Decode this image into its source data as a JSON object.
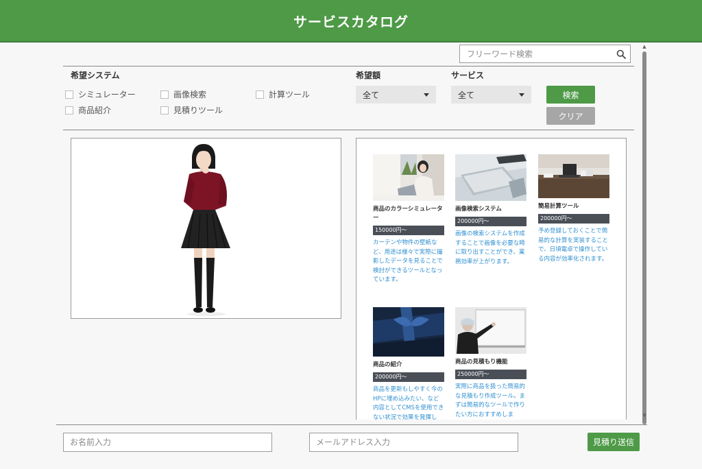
{
  "header": {
    "title": "サービスカタログ"
  },
  "search": {
    "placeholder": "フリーワード検索"
  },
  "filters": {
    "system_label": "希望システム",
    "systems": [
      "シミュレーター",
      "画像検索",
      "計算ツール",
      "商品紹介",
      "見積りツール"
    ],
    "amount_label": "希望額",
    "amount_value": "全て",
    "service_label": "サービス",
    "service_value": "全て",
    "search_button": "検索",
    "clear_button": "クリア"
  },
  "catalog": {
    "items": [
      {
        "name": "商品のカラーシミュレーター",
        "price": "150000円〜",
        "desc": "カーテンや物件の壁紙など、用途は様々で実際に撮影したデータを見ることで検討ができるツールとなっています。"
      },
      {
        "name": "画像検索システム",
        "price": "200000円〜",
        "desc": "画像の検索システムを作成することで画像を必要な時に取り出すことができ、業務効率が上がります。"
      },
      {
        "name": "簡易計算ツール",
        "price": "200000円〜",
        "desc": "予め登録しておくことで簡易的な計算を実装することで、日頃電卓で操作している内容が効率化されます。"
      },
      {
        "name": "商品の紹介",
        "price": "200000円〜",
        "desc": "商品を更新もしやすく今のHPに埋め込みたい、など内容としてCMSを使用できない状況で効果を発揮し"
      },
      {
        "name": "商品の見積もり機能",
        "price": "250000円〜",
        "desc": "実際に商品を扱った簡易的な見積もり作成ツール。まずは簡易的なツールで作りたい方におすすめしま"
      }
    ]
  },
  "footer": {
    "name_placeholder": "お名前入力",
    "email_placeholder": "メールアドレス入力",
    "send_button": "見積り送信"
  },
  "colors": {
    "brand_green": "#4e9a47",
    "link_blue": "#2f8fd0",
    "price_bg": "#4a4f57"
  },
  "icons": {
    "search": "search-icon",
    "dropdown": "caret-down-icon"
  }
}
